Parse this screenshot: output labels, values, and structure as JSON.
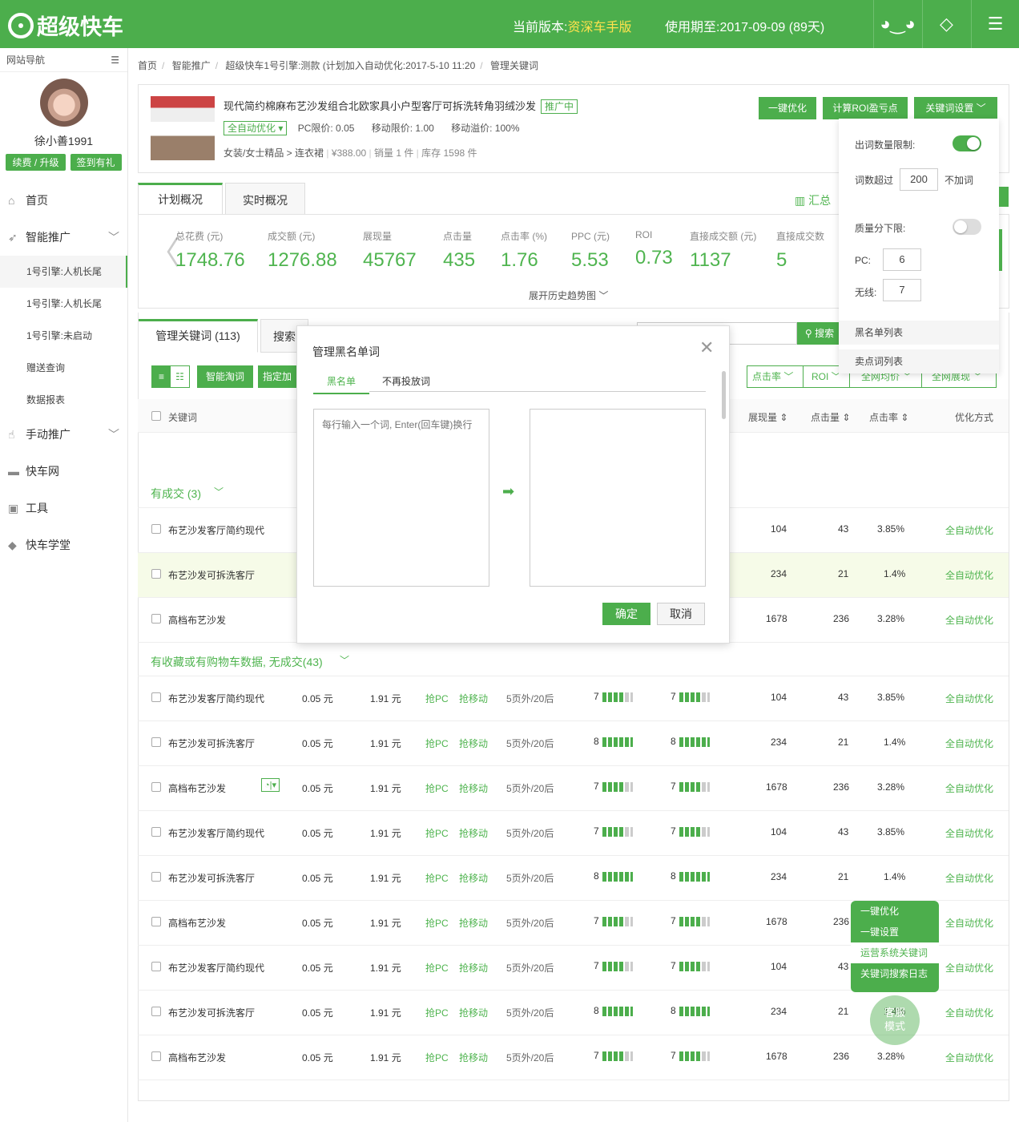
{
  "header": {
    "app_title": "超级快车",
    "version_label": "当前版本:",
    "version_value": "资深车手版",
    "period_label": "使用期至:",
    "period_value": "2017-09-09 (89天)"
  },
  "sidebar": {
    "nav_title": "网站导航",
    "username": "徐小善1991",
    "renew_label": "续费 / 升级",
    "signin_label": "签到有礼",
    "items": [
      {
        "label": "首页"
      },
      {
        "label": "智能推广"
      },
      {
        "label": "手动推广"
      },
      {
        "label": "快车网"
      },
      {
        "label": "工具"
      },
      {
        "label": "快车学堂"
      }
    ],
    "subitems": [
      {
        "label": "1号引擎:人机长尾"
      },
      {
        "label": "1号引擎:人机长尾"
      },
      {
        "label": "1号引擎:未启动"
      },
      {
        "label": "赠送查询"
      },
      {
        "label": "数据报表"
      }
    ]
  },
  "breadcrumb": {
    "items": [
      "首页",
      "智能推广",
      "超级快车1号引擎:测款 (计划加入自动优化:2017-5-10 11:20",
      "管理关键词"
    ]
  },
  "product": {
    "title": "现代简约棉麻布艺沙发组合北欧家具小户型客厅可拆洗转角羽绒沙发",
    "status_tag": "推广中",
    "auto_tag": "全自动优化",
    "pc_limit": "PC限价: 0.05",
    "mobile_limit": "移动限价: 1.00",
    "mobile_premium": "移动溢价: 100%",
    "category": "女装/女士精品 > 连衣裙",
    "price": "¥388.00",
    "sales": "销量 1 件",
    "stock": "库存 1598 件"
  },
  "actions": {
    "one_click": "一键优化",
    "roi_calc": "计算ROI盈亏点",
    "kw_settings": "关键词设置"
  },
  "overview": {
    "tab_plan": "计划概况",
    "tab_realtime": "实时概况",
    "summary": "汇总",
    "expand_trend": "展开历史趋势图",
    "metrics": [
      {
        "label": "总花费 (元)",
        "value": "1748.76"
      },
      {
        "label": "成交额 (元)",
        "value": "1276.88"
      },
      {
        "label": "展现量",
        "value": "45767"
      },
      {
        "label": "点击量",
        "value": "435"
      },
      {
        "label": "点击率 (%)",
        "value": "1.76"
      },
      {
        "label": "PPC (元)",
        "value": "5.53"
      },
      {
        "label": "ROI",
        "value": "0.73"
      },
      {
        "label": "直接成交额 (元)",
        "value": "1137"
      },
      {
        "label": "直接成交数",
        "value": "5"
      }
    ]
  },
  "kw": {
    "tab_manage": "管理关键词 (113)",
    "tab_search": "搜索",
    "search_btn": "搜索",
    "smart_btn": "智能淘词",
    "assign_btn": "指定加",
    "filters": [
      "点击率",
      "ROI",
      "全网均价",
      "全网展现"
    ],
    "headers": {
      "keyword": "关键词",
      "impressions": "展现量",
      "clicks": "点击量",
      "ctr": "点击率",
      "opt": "优化方式"
    },
    "group1": "有成交 (3)",
    "group2": "有收藏或有购物车数据, 无成交(43)",
    "group1_rows": [
      {
        "kw": "布艺沙发客厅简约现代",
        "imp": "104",
        "clk": "43",
        "ctr": "3.85%",
        "opt": "全自动优化"
      },
      {
        "kw": "布艺沙发可拆洗客厅",
        "imp": "234",
        "clk": "21",
        "ctr": "1.4%",
        "opt": "全自动优化"
      },
      {
        "kw": "高档布艺沙发",
        "imp": "1678",
        "clk": "236",
        "ctr": "3.28%",
        "opt": "全自动优化"
      }
    ],
    "rows": [
      {
        "kw": "布艺沙发客厅简约现代",
        "pc": "0.05 元",
        "mob": "1.91 元",
        "grab_pc": "抢PC",
        "grab_mob": "抢移动",
        "rank": "5页外/20后",
        "q1": "7",
        "q2": "7",
        "imp": "104",
        "clk": "43",
        "ctr": "3.85%",
        "opt": "全自动优化"
      },
      {
        "kw": "布艺沙发可拆洗客厅",
        "pc": "0.05 元",
        "mob": "1.91 元",
        "grab_pc": "抢PC",
        "grab_mob": "抢移动",
        "rank": "5页外/20后",
        "q1": "8",
        "q2": "8",
        "imp": "234",
        "clk": "21",
        "ctr": "1.4%",
        "opt": "全自动优化"
      },
      {
        "kw": "高档布艺沙发",
        "pc": "0.05 元",
        "mob": "1.91 元",
        "grab_pc": "抢PC",
        "grab_mob": "抢移动",
        "rank": "5页外/20后",
        "q1": "7",
        "q2": "7",
        "imp": "1678",
        "clk": "236",
        "ctr": "3.28%",
        "opt": "全自动优化"
      },
      {
        "kw": "布艺沙发客厅简约现代",
        "pc": "0.05 元",
        "mob": "1.91 元",
        "grab_pc": "抢PC",
        "grab_mob": "抢移动",
        "rank": "5页外/20后",
        "q1": "7",
        "q2": "7",
        "imp": "104",
        "clk": "43",
        "ctr": "3.85%",
        "opt": "全自动优化"
      },
      {
        "kw": "布艺沙发可拆洗客厅",
        "pc": "0.05 元",
        "mob": "1.91 元",
        "grab_pc": "抢PC",
        "grab_mob": "抢移动",
        "rank": "5页外/20后",
        "q1": "8",
        "q2": "8",
        "imp": "234",
        "clk": "21",
        "ctr": "1.4%",
        "opt": "全自动优化"
      },
      {
        "kw": "高档布艺沙发",
        "pc": "0.05 元",
        "mob": "1.91 元",
        "grab_pc": "抢PC",
        "grab_mob": "抢移动",
        "rank": "5页外/20后",
        "q1": "7",
        "q2": "7",
        "imp": "1678",
        "clk": "236",
        "ctr": "3.28%",
        "opt": "全自动优化"
      },
      {
        "kw": "布艺沙发客厅简约现代",
        "pc": "0.05 元",
        "mob": "1.91 元",
        "grab_pc": "抢PC",
        "grab_mob": "抢移动",
        "rank": "5页外/20后",
        "q1": "7",
        "q2": "7",
        "imp": "104",
        "clk": "43",
        "ctr": "3.85%",
        "opt": "全自动优化"
      },
      {
        "kw": "布艺沙发可拆洗客厅",
        "pc": "0.05 元",
        "mob": "1.91 元",
        "grab_pc": "抢PC",
        "grab_mob": "抢移动",
        "rank": "5页外/20后",
        "q1": "8",
        "q2": "8",
        "imp": "234",
        "clk": "21",
        "ctr": "1.4%",
        "opt": "全自动优化"
      },
      {
        "kw": "高档布艺沙发",
        "pc": "0.05 元",
        "mob": "1.91 元",
        "grab_pc": "抢PC",
        "grab_mob": "抢移动",
        "rank": "5页外/20后",
        "q1": "7",
        "q2": "7",
        "imp": "1678",
        "clk": "236",
        "ctr": "3.28%",
        "opt": "全自动优化"
      }
    ]
  },
  "modal": {
    "title": "管理黑名单词",
    "tab_blacklist": "黑名单",
    "tab_no_bid": "不再投放词",
    "placeholder": "每行输入一个词, Enter(回车键)换行",
    "confirm": "确定",
    "cancel": "取消"
  },
  "kw_settings_panel": {
    "limit_label": "出词数量限制:",
    "over_label": "词数超过",
    "over_value": "200",
    "no_add": "不加词",
    "quality_label": "质量分下限:",
    "pc_label": "PC:",
    "pc_value": "6",
    "wireless_label": "无线:",
    "wireless_value": "7",
    "blacklist": "黑名单列表",
    "selling_words": "卖点词列表"
  },
  "float_menu": {
    "items": [
      "一键优化",
      "一键设置",
      "运营系统关键词",
      "关键词搜索日志"
    ],
    "kefu": "客服模式"
  },
  "colors": {
    "brand": "#4cae4c",
    "highlight": "#f0f8a8"
  }
}
